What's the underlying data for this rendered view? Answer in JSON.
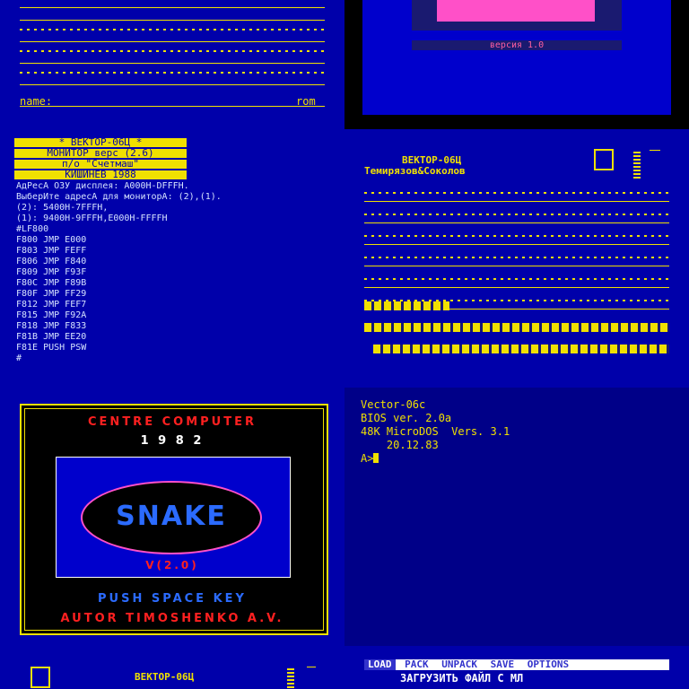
{
  "tile1": {
    "name_label": "name:",
    "rom_label": "rom"
  },
  "tile2": {
    "version_text": "версия 1.0"
  },
  "tile3": {
    "header_lines": [
      "*  ВЕКТОР-06Ц  *",
      "МОНИТОР верс (2.6)",
      "п/о   \"Счетмаш\"",
      "КИШИНЕВ 1988"
    ],
    "monitor_lines": [
      "АдРесА ОЗУ дисплея: А000Н-DFFFH.",
      "ВыберИте адресА для мониторА: (2),(1).",
      " (2): 5400H-7FFFH,",
      " (1): 9400H-9FFFH,E000H-FFFFH",
      "#LF800",
      "  F800  JMP  E000",
      "  F803  JMP  FEFF",
      "  F806  JMP  F840",
      "  F809  JMP  F93F",
      "  F80C  JMP  F89B",
      "  F80F  JMP  FF29",
      "  F812  JMP  FEF7",
      "  F815  JMP  F92A",
      "  F818  JMP  F833",
      "  F81B  JMP  EE20",
      "  F81E  PUSH PSW",
      "#"
    ]
  },
  "tile4": {
    "title": "ВЕКТОР-06Ц",
    "authors": "Темирязов&Соколов"
  },
  "tile5": {
    "top_title": "CENTRE COMPUTER",
    "year": "1 9 8 2",
    "game_name": "SNAKE",
    "version": "V(2.0)",
    "push_key": "PUSH SPACE KEY",
    "author": "AUTOR TIMOSHENKO A.V."
  },
  "tile6": {
    "lines": [
      "Vector-06c",
      "BIOS ver. 2.0a",
      "48K MicroDOS  Vers. 3.1",
      "    20.12.83",
      "A>"
    ]
  },
  "tile7": {
    "title": "ВЕКТОР-06Ц"
  },
  "tile8": {
    "menu": [
      "LOAD",
      "PACK",
      "UNPACK",
      "SAVE",
      "OPTIONS"
    ],
    "status": "ЗАГРУЗИТЬ ФАЙЛ С МЛ"
  },
  "colors": {
    "background": "#0000aa",
    "yellow": "#f0e000",
    "red": "#ff1a1a",
    "magenta": "#ff40c0"
  }
}
